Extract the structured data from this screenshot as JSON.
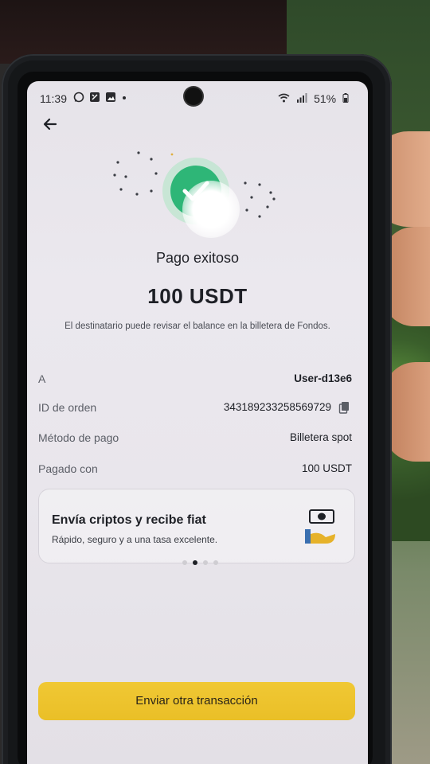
{
  "status_bar": {
    "time": "11:39",
    "battery": "51%",
    "icons": [
      "whatsapp-icon",
      "notification-icon",
      "gallery-icon",
      "dot-icon",
      "wifi-icon",
      "signal-icon",
      "battery-icon"
    ]
  },
  "header": {
    "back_icon": "back-arrow-icon"
  },
  "success": {
    "title": "Pago exitoso",
    "amount": "100 USDT",
    "message": "El destinatario puede revisar el balance en la billetera de Fondos.",
    "accent_color": "#2eb677"
  },
  "details": [
    {
      "label": "A",
      "value": "User-d13e6"
    },
    {
      "label": "ID de orden",
      "value": "343189233258569729"
    },
    {
      "label": "Método de pago",
      "value": "Billetera spot"
    },
    {
      "label": "Pagado con",
      "value": "100 USDT"
    }
  ],
  "promo": {
    "title": "Envía criptos y recibe fiat",
    "subtitle": "Rápido, seguro y a una tasa excelente.",
    "carousel_active_index": 1,
    "carousel_count": 4
  },
  "actions": {
    "primary_label": "Enviar otra transacción",
    "primary_color": "#f0c834"
  }
}
